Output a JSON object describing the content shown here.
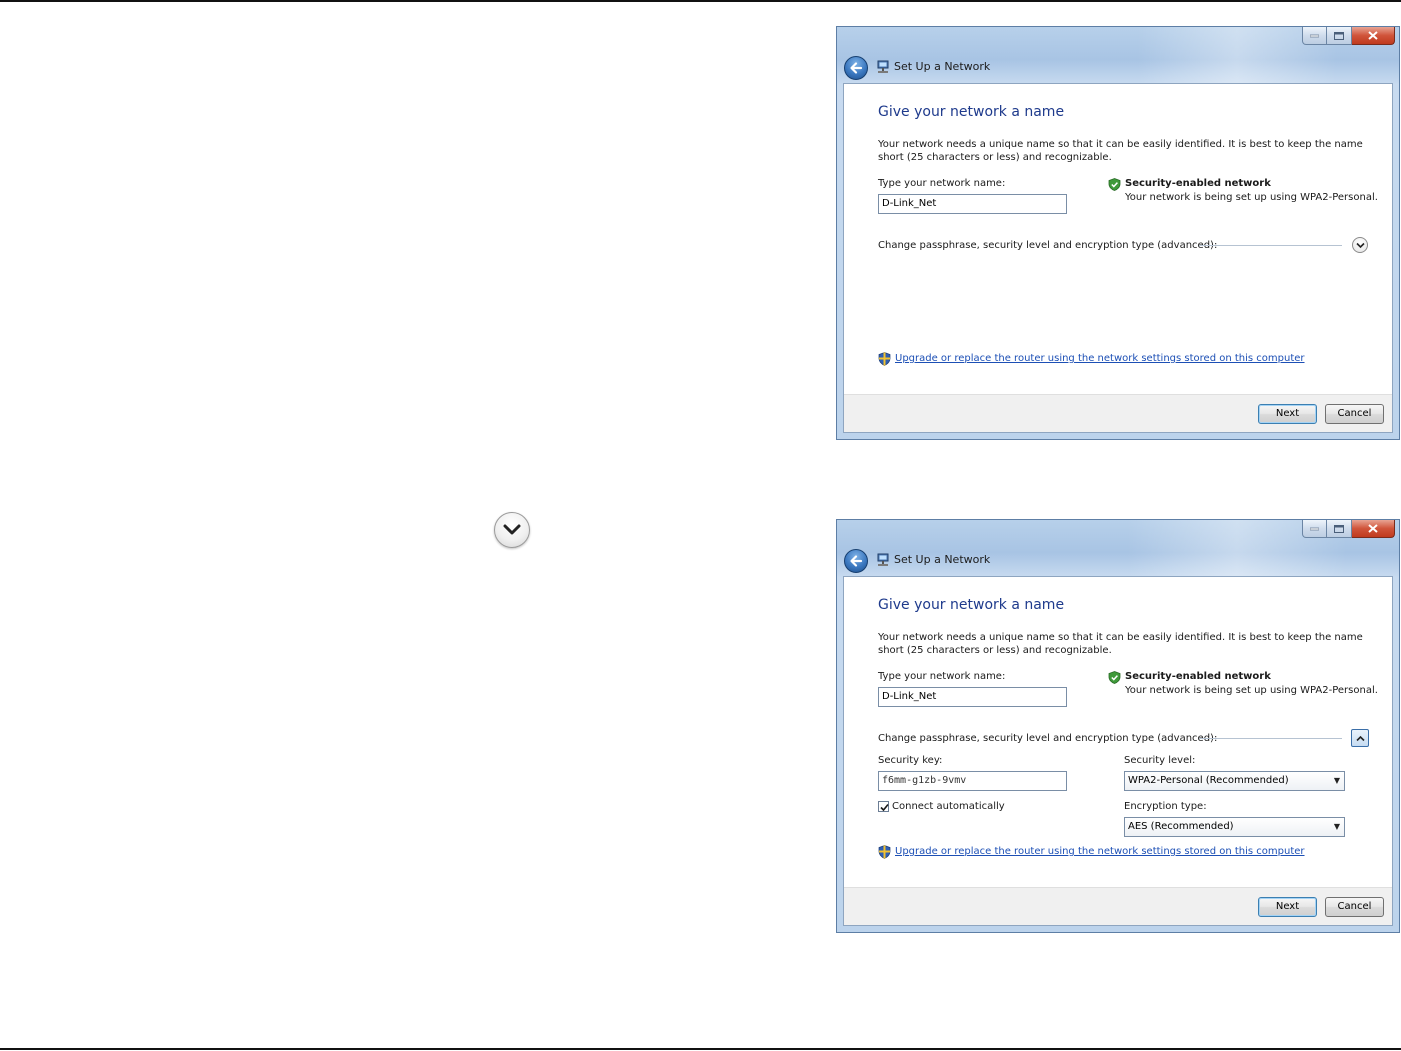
{
  "standalone_icon": "chevron-down-circle-icon",
  "dialogs": [
    {
      "title": "Set Up a Network",
      "heading": "Give your network a name",
      "description": "Your network needs a unique name so that it can be easily identified. It is best to keep the name short (25 characters or less) and recognizable.",
      "network_name_label": "Type your network name:",
      "network_name_value": "D-Link_Net",
      "security_title": "Security-enabled network",
      "security_subtitle": "Your network is being set up using WPA2-Personal.",
      "advanced_label": "Change passphrase, security level and encryption type (advanced):",
      "advanced_expanded": false,
      "upgrade_link": "Upgrade or replace the router using the network settings stored on this computer",
      "next_label": "Next",
      "cancel_label": "Cancel"
    },
    {
      "title": "Set Up a Network",
      "heading": "Give your network a name",
      "description": "Your network needs a unique name so that it can be easily identified. It is best to keep the name short (25 characters or less) and recognizable.",
      "network_name_label": "Type your network name:",
      "network_name_value": "D-Link_Net",
      "security_title": "Security-enabled network",
      "security_subtitle": "Your network is being set up using WPA2-Personal.",
      "advanced_label": "Change passphrase, security level and encryption type (advanced):",
      "advanced_expanded": true,
      "security_key_label": "Security key:",
      "security_key_value": "f6mm-g1zb-9vmv",
      "connect_auto_label": "Connect automatically",
      "connect_auto_checked": true,
      "security_level_label": "Security level:",
      "security_level_value": "WPA2-Personal (Recommended)",
      "encryption_type_label": "Encryption type:",
      "encryption_type_value": "AES (Recommended)",
      "upgrade_link": "Upgrade or replace the router using the network settings stored on this computer",
      "next_label": "Next",
      "cancel_label": "Cancel"
    }
  ],
  "colors": {
    "heading": "#1e3a8c",
    "link": "#1c4fb5",
    "frame": "#bcd3ec",
    "close_button": "#c03a1e"
  }
}
